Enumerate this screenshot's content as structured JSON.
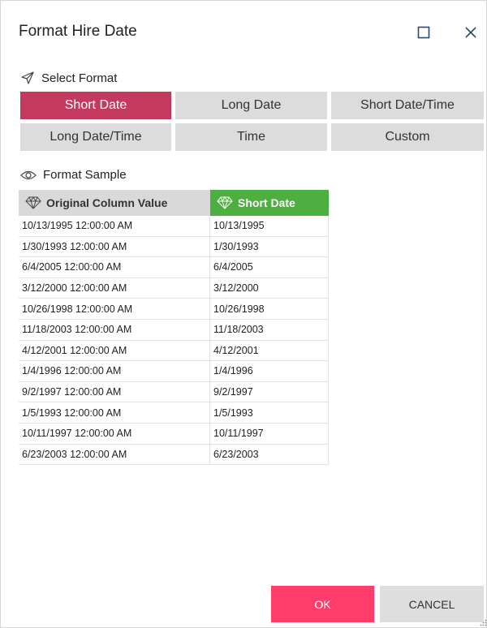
{
  "dialog": {
    "title": "Format Hire Date",
    "maximize_icon": "maximize-icon",
    "close_icon": "close-icon"
  },
  "select_format": {
    "label": "Select Format",
    "icon": "cursor-arrow-icon",
    "options": [
      {
        "label": "Short Date",
        "active": true
      },
      {
        "label": "Long Date",
        "active": false
      },
      {
        "label": "Short Date/Time",
        "active": false
      },
      {
        "label": "Long Date/Time",
        "active": false
      },
      {
        "label": "Time",
        "active": false
      },
      {
        "label": "Custom",
        "active": false
      }
    ],
    "active_color": "#c43a5e"
  },
  "format_sample": {
    "label": "Format Sample",
    "icon": "eye-icon",
    "columns": [
      {
        "label": "Original Column Value",
        "icon": "gem-icon"
      },
      {
        "label": "Short Date",
        "icon": "diamond-icon",
        "color": "#4caf3f"
      }
    ],
    "rows": [
      [
        "10/13/1995 12:00:00 AM",
        "10/13/1995"
      ],
      [
        "1/30/1993 12:00:00 AM",
        "1/30/1993"
      ],
      [
        "6/4/2005 12:00:00 AM",
        "6/4/2005"
      ],
      [
        "3/12/2000 12:00:00 AM",
        "3/12/2000"
      ],
      [
        "10/26/1998 12:00:00 AM",
        "10/26/1998"
      ],
      [
        "11/18/2003 12:00:00 AM",
        "11/18/2003"
      ],
      [
        "4/12/2001 12:00:00 AM",
        "4/12/2001"
      ],
      [
        "1/4/1996 12:00:00 AM",
        "1/4/1996"
      ],
      [
        "9/2/1997 12:00:00 AM",
        "9/2/1997"
      ],
      [
        "1/5/1993 12:00:00 AM",
        "1/5/1993"
      ],
      [
        "10/11/1997 12:00:00 AM",
        "10/11/1997"
      ],
      [
        "6/23/2003 12:00:00 AM",
        "6/23/2003"
      ]
    ]
  },
  "footer": {
    "ok_label": "OK",
    "cancel_label": "CANCEL",
    "ok_color": "#ff3d6b"
  }
}
